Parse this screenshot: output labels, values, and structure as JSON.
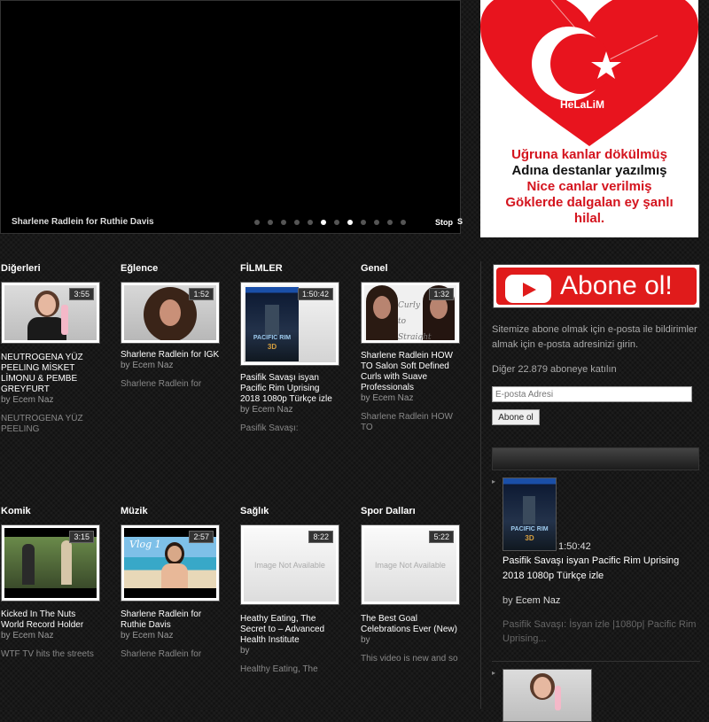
{
  "slider": {
    "caption": "Sharlene Radlein for Ruthie Davis",
    "stop_label": "Stop",
    "next_label": "S",
    "dots": [
      false,
      false,
      false,
      false,
      false,
      true,
      false,
      true,
      false,
      false,
      false,
      false
    ]
  },
  "banner": {
    "brand": "HeLaLiM",
    "lines": [
      "Uğruna kanlar dökülmüş",
      "Adına destanlar yazılmış",
      "Nice canlar verilmiş",
      "Göklerde dalgalan ey şanlı",
      "hilal."
    ],
    "colors": {
      "heart": "#e8141e",
      "line_red": "#d4141e",
      "line_dark": "#111111"
    }
  },
  "categories": [
    {
      "name": "Diğerleri",
      "duration": "3:55",
      "title": "NEUTROGENA YÜZ PEELING MİSKET LİMONU & PEMBE GREYFURT",
      "by": "by",
      "author": "Ecem Naz",
      "excerpt": "NEUTROGENA YÜZ PEELING"
    },
    {
      "name": "Eğlence",
      "duration": "1:52",
      "title": "Sharlene Radlein for IGK",
      "by": "by",
      "author": "Ecem Naz",
      "excerpt": "Sharlene Radlein for"
    },
    {
      "name": "FİLMLER",
      "duration": "1:50:42",
      "title": "Pasifik Savaşı isyan Pacific Rim Uprising 2018 1080p Türkçe izle",
      "by": "by",
      "author": "Ecem Naz",
      "excerpt": "Pasifik Savaşı:"
    },
    {
      "name": "Genel",
      "duration": "1:32",
      "title": "Sharlene Radlein HOW TO Salon Soft Defined Curls with Suave Professionals",
      "by": "by",
      "author": "Ecem Naz",
      "excerpt": "Sharlene Radlein HOW TO",
      "overlay_text": "Curly to Straight"
    },
    {
      "name": "Komik",
      "duration": "3:15",
      "title": "Kicked In The Nuts World Record Holder",
      "by": "by",
      "author": "Ecem Naz",
      "excerpt": "WTF TV hits the streets"
    },
    {
      "name": "Müzik",
      "duration": "2:57",
      "title": "Sharlene Radlein for Ruthie Davis",
      "by": "by",
      "author": "Ecem Naz",
      "excerpt": "Sharlene Radlein for",
      "overlay_text": "Vlog 1"
    },
    {
      "name": "Sağlık",
      "duration": "8:22",
      "title": "Heathy Eating, The Secret to – Advanced Health Institute",
      "by": "by",
      "author": "",
      "excerpt": "Healthy Eating, The",
      "na_label": "Image Not Available"
    },
    {
      "name": "Spor Dalları",
      "duration": "5:22",
      "title": "The Best Goal Celebrations Ever (New)",
      "by": "by",
      "author": "",
      "excerpt": "This video is new and so",
      "na_label": "Image Not Available"
    }
  ],
  "sidebar": {
    "abone_label": "Abone ol!",
    "description": "Sitemize abone olmak için e-posta ile bildirimler almak için e-posta adresinizi girin.",
    "subscribers": "Diğer 22.879 aboneye katılın",
    "email_placeholder": "E-posta Adresi",
    "subscribe_button": "Abone ol",
    "featured": {
      "duration": "1:50:42",
      "title": "Pasifik Savaşı isyan Pacific Rim Uprising 2018 1080p Türkçe izle",
      "by": "by",
      "author": "Ecem Naz",
      "excerpt": "Pasifik Savaşı: İsyan izle |1080p| Pacific Rim Uprising..."
    }
  },
  "poster": {
    "title": "PACIFIC RIM",
    "subtitle": "3D"
  }
}
